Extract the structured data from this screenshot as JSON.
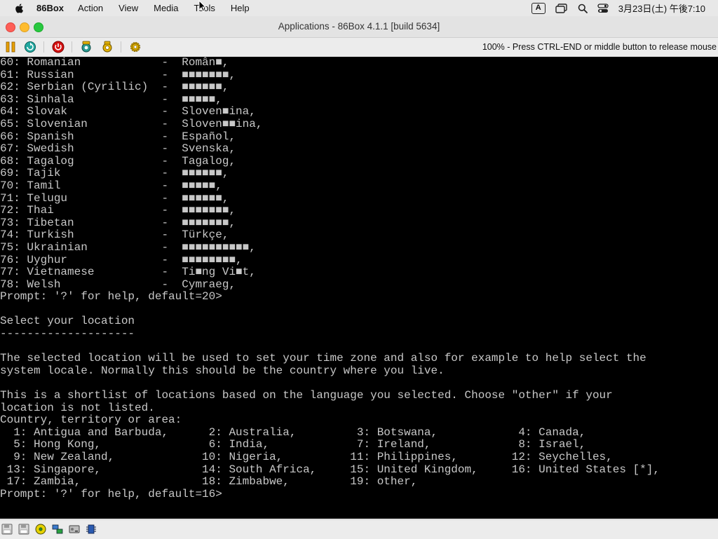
{
  "menubar": {
    "app_name": "86Box",
    "items": [
      "Action",
      "View",
      "Media",
      "Tools",
      "Help"
    ],
    "input_indicator": "A",
    "clock": "3月23日(土) 午後7:10"
  },
  "window": {
    "title": "Applications - 86Box 4.1.1 [build 5634]"
  },
  "toolbar": {
    "status_message": "100% - Press CTRL-END or middle button to release mouse",
    "buttons": [
      {
        "icon": "pause-icon",
        "color": "#e8a000"
      },
      {
        "icon": "hard-reset-icon",
        "color": "#1a9a8a"
      },
      {
        "icon": "ctrl-alt-del-icon",
        "color": "#d40000"
      },
      {
        "icon": "settings-icon",
        "color": "#e0b000"
      },
      {
        "icon": "screenshot-icon",
        "color": "#e0b000"
      },
      {
        "icon": "gear-icon",
        "color": "#e0b000"
      }
    ]
  },
  "terminal": {
    "lines": [
      "60: Romanian            -  Român■,",
      "61: Russian             -  ■■■■■■■,",
      "62: Serbian (Cyrillic)  -  ■■■■■■,",
      "63: Sinhala             -  ■■■■■,",
      "64: Slovak              -  Sloven■ina,",
      "65: Slovenian           -  Sloven■■ina,",
      "66: Spanish             -  Español,",
      "67: Swedish             -  Svenska,",
      "68: Tagalog             -  Tagalog,",
      "69: Tajik               -  ■■■■■■,",
      "70: Tamil               -  ■■■■■,",
      "71: Telugu              -  ■■■■■■,",
      "72: Thai                -  ■■■■■■■,",
      "73: Tibetan             -  ■■■■■■■,",
      "74: Turkish             -  Türkçe,",
      "75: Ukrainian           -  ■■■■■■■■■■,",
      "76: Uyghur              -  ■■■■■■■■,",
      "77: Vietnamese          -  Ti■ng Vi■t,",
      "78: Welsh               -  Cymraeg,",
      "Prompt: '?' for help, default=20>",
      "",
      "Select your location",
      "--------------------",
      "",
      "The selected location will be used to set your time zone and also for example to help select the",
      "system locale. Normally this should be the country where you live.",
      "",
      "This is a shortlist of locations based on the language you selected. Choose \"other\" if your",
      "location is not listed.",
      "Country, territory or area:",
      "  1: Antigua and Barbuda,      2: Australia,         3: Botswana,            4: Canada,",
      "  5: Hong Kong,                6: India,             7: Ireland,             8: Israel,",
      "  9: New Zealand,             10: Nigeria,          11: Philippines,        12: Seychelles,",
      " 13: Singapore,               14: South Africa,     15: United Kingdom,     16: United States [*],",
      " 17: Zambia,                  18: Zimbabwe,         19: other,",
      "Prompt: '?' for help, default=16>"
    ]
  },
  "statusbar": {
    "icons": [
      "floppy-drive-1-icon",
      "floppy-drive-2-icon",
      "cdrom-icon",
      "network-icon",
      "hard-disk-icon",
      "sound-icon"
    ]
  }
}
